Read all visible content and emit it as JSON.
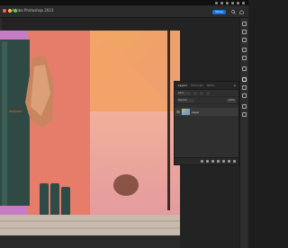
{
  "app": {
    "title": "Adobe Photoshop 2023",
    "share_label": "Share"
  },
  "layers_panel": {
    "tabs": [
      "Layers",
      "Channels",
      "Paths"
    ],
    "kind_label": "Kind",
    "blend_mode": "Normal",
    "opacity": "100%",
    "fill": "100%",
    "layer_name": "Layer"
  },
  "right_toolbar": {
    "icons": [
      "color-icon",
      "swatches-icon",
      "libraries-icon",
      "properties-icon",
      "adjustments-icon",
      "learn-icon",
      "layers-icon",
      "channels-icon",
      "paths-icon",
      "history-icon",
      "brush-icon"
    ]
  },
  "colors": {
    "accent": "#1473e6",
    "wall_orange": "#e58c5a",
    "wall_pink": "#e8a0a8",
    "door_green": "#2f4a44"
  }
}
